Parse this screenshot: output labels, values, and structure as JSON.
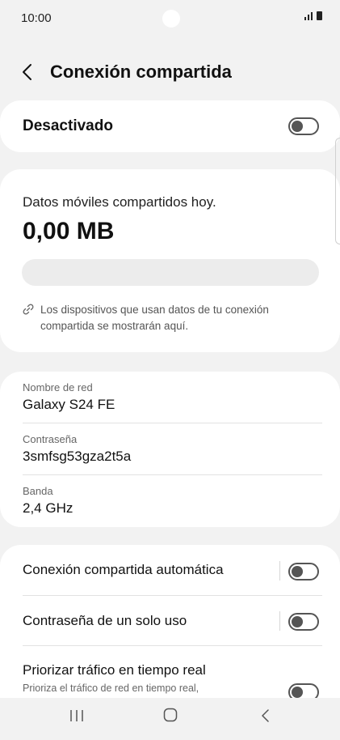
{
  "status": {
    "time": "10:00"
  },
  "header": {
    "title": "Conexión compartida"
  },
  "main_toggle": {
    "label": "Desactivado",
    "enabled": false
  },
  "data_usage": {
    "label": "Datos móviles compartidos hoy.",
    "value": "0,00 MB",
    "progress_fraction": 0,
    "note": "Los dispositivos que usan datos de tu conexión compartida se mostrarán aquí."
  },
  "network": {
    "name_label": "Nombre de red",
    "name_value": "Galaxy S24 FE",
    "password_label": "Contraseña",
    "password_value": "3smfsg53gza2t5a",
    "band_label": "Banda",
    "band_value": "2,4 GHz"
  },
  "options": [
    {
      "label": "Conexión compartida automática",
      "enabled": false
    },
    {
      "label": "Contraseña de un solo uso",
      "enabled": false
    },
    {
      "label": "Priorizar tráfico en tiempo real",
      "sub": "Prioriza el tráfico de red en tiempo real,",
      "enabled": false
    }
  ],
  "colors": {
    "background": "#f2f2f2",
    "card": "#ffffff",
    "accent": "#3e91ff",
    "toggle_off": "#555555"
  }
}
